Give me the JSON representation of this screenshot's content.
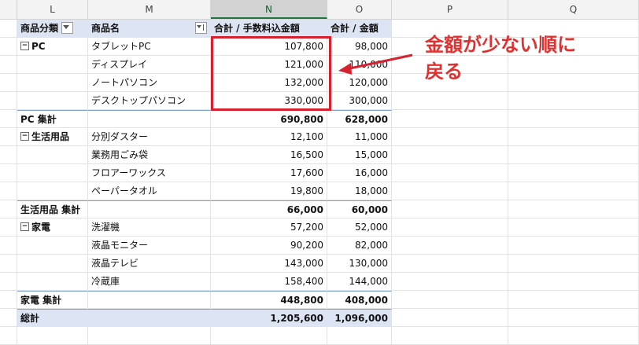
{
  "columns": [
    "L",
    "M",
    "N",
    "O",
    "P",
    "Q"
  ],
  "header": {
    "category": "商品分類",
    "product": "商品名",
    "with_fee": "合計 / 手数料込金額",
    "amount": "合計 / 金額"
  },
  "groups": [
    {
      "name": "PC",
      "rows": [
        {
          "product": "タブレットPC",
          "with_fee": "107,800",
          "amount": "98,000"
        },
        {
          "product": "ディスプレイ",
          "with_fee": "121,000",
          "amount": "110,000"
        },
        {
          "product": "ノートパソコン",
          "with_fee": "132,000",
          "amount": "120,000"
        },
        {
          "product": "デスクトップパソコン",
          "with_fee": "330,000",
          "amount": "300,000"
        }
      ],
      "subtotal": {
        "label": "PC 集計",
        "with_fee": "690,800",
        "amount": "628,000"
      }
    },
    {
      "name": "生活用品",
      "rows": [
        {
          "product": "分別ダスター",
          "with_fee": "12,100",
          "amount": "11,000"
        },
        {
          "product": "業務用ごみ袋",
          "with_fee": "16,500",
          "amount": "15,000"
        },
        {
          "product": "フロアーワックス",
          "with_fee": "17,600",
          "amount": "16,000"
        },
        {
          "product": "ペーパータオル",
          "with_fee": "19,800",
          "amount": "18,000"
        }
      ],
      "subtotal": {
        "label": "生活用品 集計",
        "with_fee": "66,000",
        "amount": "60,000"
      }
    },
    {
      "name": "家電",
      "rows": [
        {
          "product": "洗濯機",
          "with_fee": "57,200",
          "amount": "52,000"
        },
        {
          "product": "液晶モニター",
          "with_fee": "90,200",
          "amount": "82,000"
        },
        {
          "product": "液晶テレビ",
          "with_fee": "143,000",
          "amount": "130,000"
        },
        {
          "product": "冷蔵庫",
          "with_fee": "158,400",
          "amount": "144,000"
        }
      ],
      "subtotal": {
        "label": "家電 集計",
        "with_fee": "448,800",
        "amount": "408,000"
      }
    }
  ],
  "grand_total": {
    "label": "総計",
    "with_fee": "1,205,600",
    "amount": "1,096,000"
  },
  "annotation": {
    "line1": "金額が少ない順に",
    "line2": "戻る",
    "color": "#e03030"
  },
  "colors": {
    "accent": "#217346",
    "pivot_header": "#dde5f4",
    "highlight_box": "#d8202f"
  }
}
